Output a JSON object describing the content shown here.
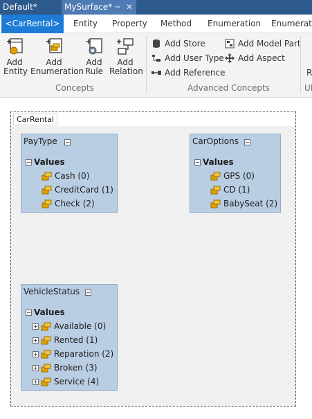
{
  "doc_tabs": [
    {
      "label": "Default*"
    },
    {
      "label": "MySurface*",
      "pin": "pin-icon",
      "close": "close-icon"
    }
  ],
  "ribbon_tabs": [
    {
      "label": "<CarRental>"
    },
    {
      "label": "Entity"
    },
    {
      "label": "Property"
    },
    {
      "label": "Method"
    },
    {
      "label": "Enumeration"
    },
    {
      "label": "Enumeratio"
    }
  ],
  "ribbon": {
    "concepts": {
      "group_label": "Concepts",
      "buttons": [
        {
          "line1": "Add",
          "line2": "Entity",
          "icon": "add-entity-icon"
        },
        {
          "line1": "Add",
          "line2": "Enumeration",
          "icon": "add-enumeration-icon"
        },
        {
          "line1": "Add",
          "line2": "Rule",
          "icon": "add-rule-icon"
        },
        {
          "line1": "Add",
          "line2": "Relation",
          "icon": "add-relation-icon"
        }
      ]
    },
    "advanced": {
      "group_label": "Advanced Concepts",
      "buttons": [
        {
          "label": "Add Store",
          "icon": "database-icon"
        },
        {
          "label": "Add User Type",
          "icon": "user-type-icon"
        },
        {
          "label": "Add Reference",
          "icon": "reference-icon"
        },
        {
          "label": "Add Model Part",
          "icon": "model-part-icon"
        },
        {
          "label": "Add Aspect",
          "icon": "aspect-icon"
        }
      ]
    },
    "partial_group": {
      "button_fragment": "R",
      "label_fragment": "UI"
    }
  },
  "surface": {
    "title": "CarRental",
    "shapes": [
      {
        "name": "PayType",
        "section": "Values",
        "items": [
          {
            "label": "Cash (0)"
          },
          {
            "label": "CreditCard (1)"
          },
          {
            "label": "Check (2)"
          }
        ]
      },
      {
        "name": "CarOptions",
        "section": "Values",
        "items": [
          {
            "label": "GPS (0)"
          },
          {
            "label": "CD (1)"
          },
          {
            "label": "BabySeat (2)"
          }
        ]
      },
      {
        "name": "VehicleStatus",
        "section": "Values",
        "items": [
          {
            "label": "Available (0)"
          },
          {
            "label": "Rented (1)"
          },
          {
            "label": "Reparation (2)"
          },
          {
            "label": "Broken (3)"
          },
          {
            "label": "Service (4)"
          }
        ]
      }
    ]
  },
  "colors": {
    "doc_tab_bg": "#2d5a8c",
    "active_doc_tab": "#4e7bb3",
    "active_ribbon_tab": "#1e7cd6",
    "shape_fill": "#b9cde3",
    "literal_icon": "#e0a100"
  }
}
